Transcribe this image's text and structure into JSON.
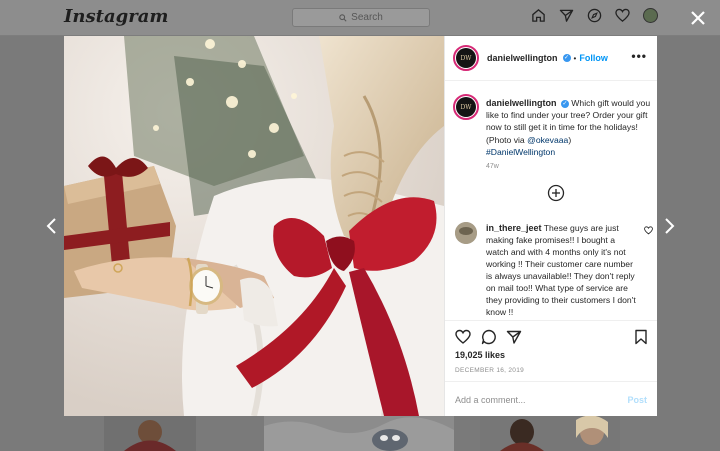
{
  "topbar": {
    "logo": "Instagram",
    "search_placeholder": "Search",
    "icons": [
      "home-icon",
      "direct-icon",
      "explore-icon",
      "heart-icon",
      "profile-avatar"
    ]
  },
  "close_icon": "close-icon",
  "nav": {
    "prev_icon": "chevron-left-icon",
    "next_icon": "chevron-right-icon"
  },
  "post": {
    "avatar_text": "DW",
    "username": "danielwellington",
    "follow_label": "Follow",
    "separator": "•",
    "caption": {
      "username": "danielwellington",
      "text": "Which gift would you like to find under your tree? Order your gift now to still get it in time for the holidays! (Photo via ",
      "mention": "@okevaaa",
      "text_end": ")",
      "hashtag": "#DanielWellington"
    },
    "time_ago": "47w",
    "comments": [
      {
        "username": "in_there_jeet",
        "text": "These guys are just making fake promises!! I bought a watch and with 4 months only it's not working !! Their customer care number is always unavailable!! They don't reply on mail too!! What type of service are they providing to their customers I don't know !!"
      }
    ],
    "likes": "19,025 likes",
    "date": "DECEMBER 16, 2019",
    "add_comment_placeholder": "Add a comment...",
    "post_label": "Post"
  },
  "colors": {
    "accent_blue": "#0095f6",
    "ring_pink": "#d62976",
    "overlay_gray": "#7a7a7a"
  }
}
